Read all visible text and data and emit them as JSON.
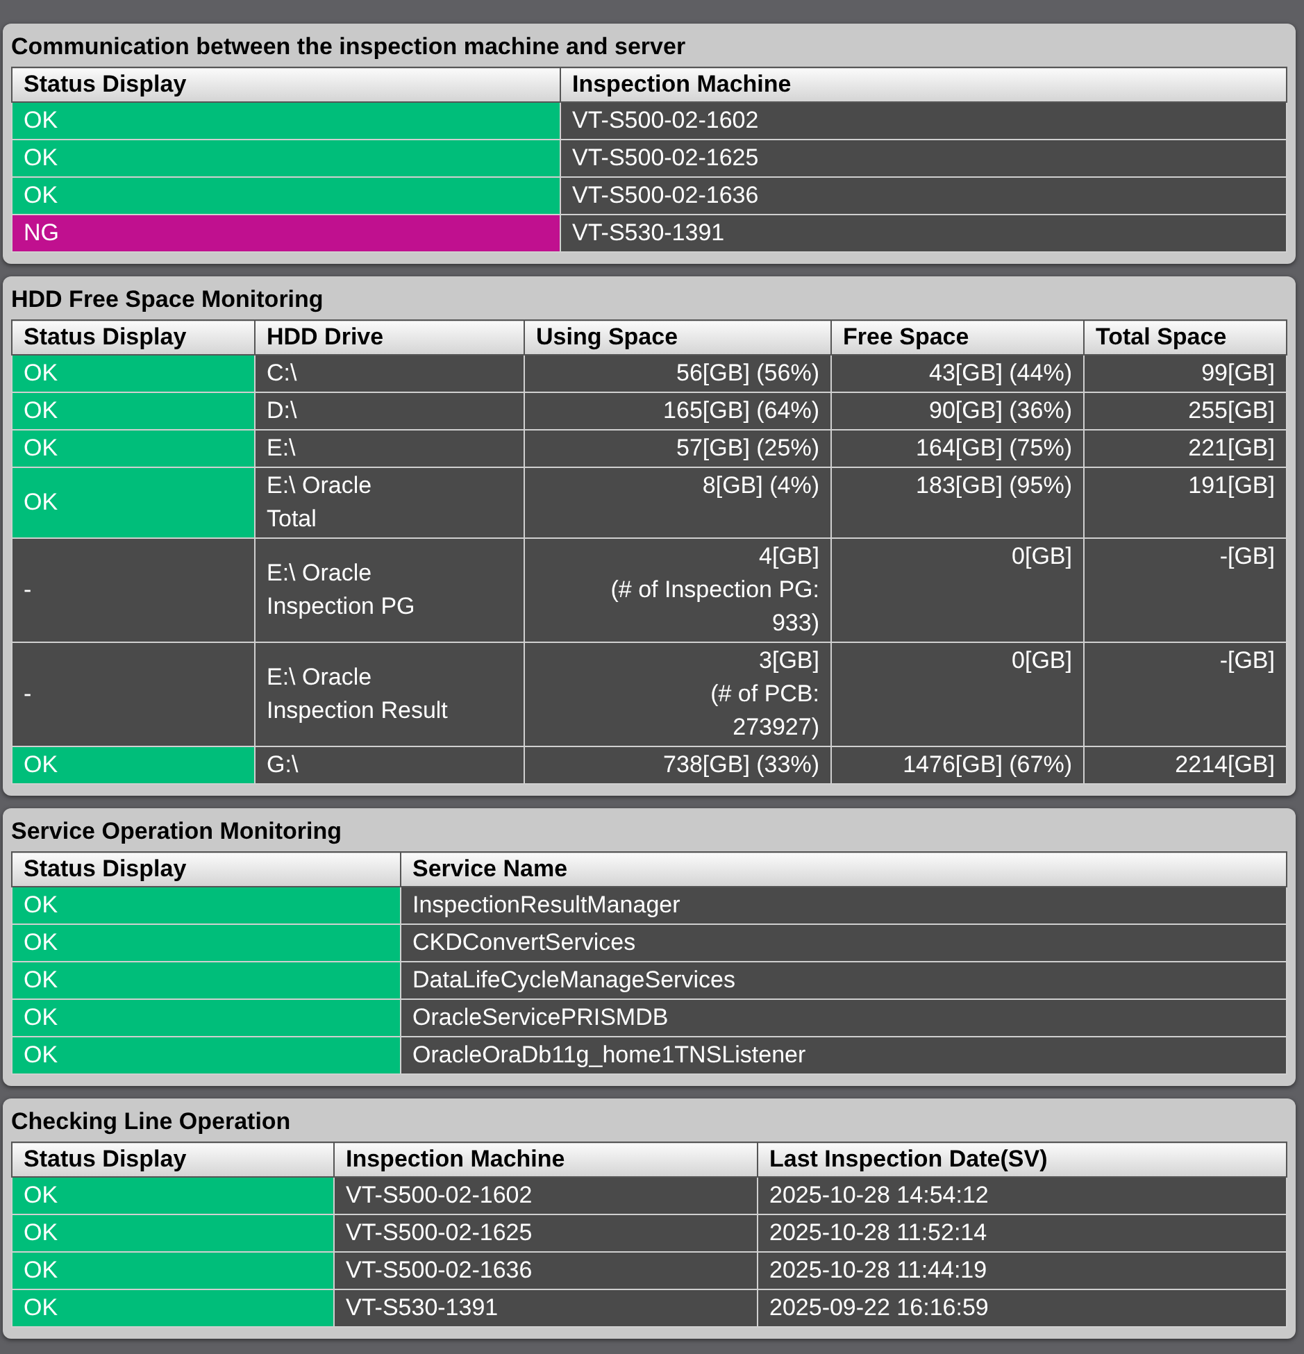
{
  "sections": [
    {
      "title": "Communication between the inspection machine and server",
      "columns": [
        {
          "label": "Status Display",
          "kind": "status"
        },
        {
          "label": "Inspection Machine",
          "kind": "text"
        }
      ],
      "rows": [
        {
          "color": "#00be7a",
          "cells": [
            "OK",
            "VT-S500-02-1602"
          ]
        },
        {
          "color": "#00be7a",
          "cells": [
            "OK",
            "VT-S500-02-1625"
          ]
        },
        {
          "color": "#00be7a",
          "cells": [
            "OK",
            "VT-S500-02-1636"
          ]
        },
        {
          "color": "#c0108f",
          "cells": [
            "NG",
            "VT-S530-1391"
          ]
        }
      ]
    },
    {
      "title": "HDD Free Space Monitoring",
      "columns": [
        {
          "label": "Status Display",
          "kind": "status"
        },
        {
          "label": "HDD Drive",
          "kind": "text"
        },
        {
          "label": "Using Space",
          "kind": "number"
        },
        {
          "label": "Free Space",
          "kind": "number"
        },
        {
          "label": "Total Space",
          "kind": "number"
        }
      ],
      "rows": [
        {
          "color": "#00be7a",
          "cells": [
            "OK",
            "C:\\",
            "56[GB] (56%)",
            "43[GB] (44%)",
            "99[GB]"
          ]
        },
        {
          "color": "#00be7a",
          "cells": [
            "OK",
            "D:\\",
            "165[GB] (64%)",
            "90[GB] (36%)",
            "255[GB]"
          ]
        },
        {
          "color": "#00be7a",
          "cells": [
            "OK",
            "E:\\",
            "57[GB] (25%)",
            "164[GB] (75%)",
            "221[GB]"
          ]
        },
        {
          "color": "#00be7a",
          "cells": [
            "OK",
            "E:\\ Oracle\nTotal",
            "8[GB] (4%)",
            "183[GB] (95%)",
            "191[GB]"
          ]
        },
        {
          "cells": [
            "-",
            "E:\\ Oracle\nInspection PG",
            "4[GB]\n(# of Inspection PG:\n933)",
            "0[GB]",
            "-[GB]"
          ]
        },
        {
          "cells": [
            "-",
            "E:\\ Oracle\nInspection Result",
            "3[GB]\n(# of PCB:\n273927)",
            "0[GB]",
            "-[GB]"
          ]
        },
        {
          "color": "#00be7a",
          "cells": [
            "OK",
            "G:\\",
            "738[GB] (33%)",
            "1476[GB] (67%)",
            "2214[GB]"
          ]
        }
      ]
    },
    {
      "title": "Service Operation Monitoring",
      "columns": [
        {
          "label": "Status Display",
          "kind": "status"
        },
        {
          "label": "Service Name",
          "kind": "text"
        }
      ],
      "rows": [
        {
          "color": "#00be7a",
          "cells": [
            "OK",
            "InspectionResultManager"
          ]
        },
        {
          "color": "#00be7a",
          "cells": [
            "OK",
            "CKDConvertServices"
          ]
        },
        {
          "color": "#00be7a",
          "cells": [
            "OK",
            "DataLifeCycleManageServices"
          ]
        },
        {
          "color": "#00be7a",
          "cells": [
            "OK",
            "OracleServicePRISMDB"
          ]
        },
        {
          "color": "#00be7a",
          "cells": [
            "OK",
            "OracleOraDb11g_home1TNSListener"
          ]
        }
      ]
    },
    {
      "title": "Checking Line Operation",
      "columns": [
        {
          "label": "Status Display",
          "kind": "status"
        },
        {
          "label": "Inspection Machine",
          "kind": "text"
        },
        {
          "label": "Last Inspection Date(SV)",
          "kind": "text"
        }
      ],
      "rows": [
        {
          "color": "#00be7a",
          "cells": [
            "OK",
            "VT-S500-02-1602",
            "2025-10-28 14:54:12"
          ]
        },
        {
          "color": "#00be7a",
          "cells": [
            "OK",
            "VT-S500-02-1625",
            "2025-10-28 11:52:14"
          ]
        },
        {
          "color": "#00be7a",
          "cells": [
            "OK",
            "VT-S500-02-1636",
            "2025-10-28 11:44:19"
          ]
        },
        {
          "color": "#00be7a",
          "cells": [
            "OK",
            "VT-S530-1391",
            "2025-09-22 16:16:59"
          ]
        }
      ]
    }
  ]
}
